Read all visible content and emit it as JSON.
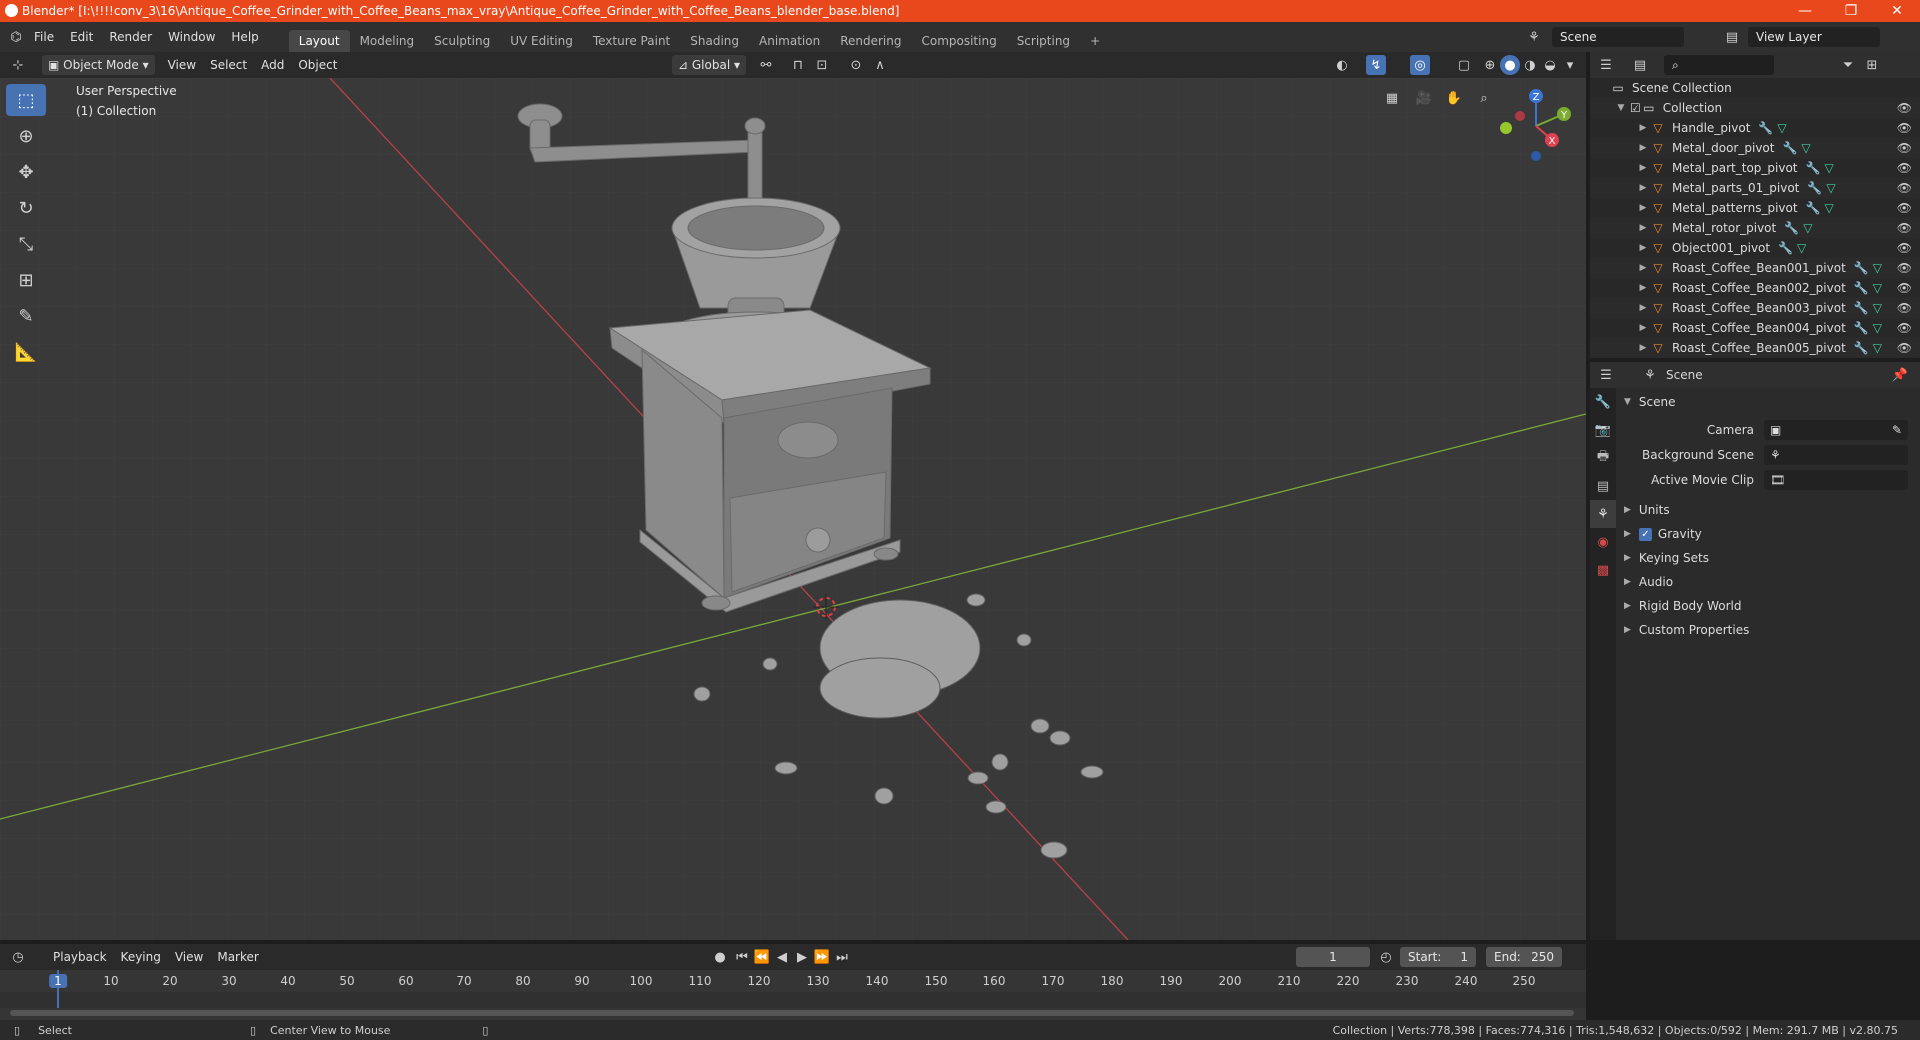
{
  "window": {
    "title": "Blender* [I:\\!!!!conv_3\\16\\Antique_Coffee_Grinder_with_Coffee_Beans_max_vray\\Antique_Coffee_Grinder_with_Coffee_Beans_blender_base.blend]",
    "minimize": "—",
    "maximize": "❐",
    "close": "✕"
  },
  "menu": [
    "File",
    "Edit",
    "Render",
    "Window",
    "Help"
  ],
  "workspaces": [
    "Layout",
    "Modeling",
    "Sculpting",
    "UV Editing",
    "Texture Paint",
    "Shading",
    "Animation",
    "Rendering",
    "Compositing",
    "Scripting"
  ],
  "active_workspace": "Layout",
  "scene_field": "Scene",
  "view_layer_field": "View Layer",
  "viewport_header": {
    "mode": "Object Mode",
    "menus": [
      "View",
      "Select",
      "Add",
      "Object"
    ],
    "transform_orientation": "Global"
  },
  "viewport": {
    "perspective_label": "User Perspective",
    "collection_label": "(1) Collection",
    "gizmo_axes": {
      "z": "Z",
      "y": "Y",
      "x": "X"
    }
  },
  "outliner": {
    "scene_collection": "Scene Collection",
    "collection": "Collection",
    "objects": [
      "Handle_pivot",
      "Metal_door_pivot",
      "Metal_part_top_pivot",
      "Metal_parts_01_pivot",
      "Metal_patterns_pivot",
      "Metal_rotor_pivot",
      "Object001_pivot",
      "Roast_Coffee_Bean001_pivot",
      "Roast_Coffee_Bean002_pivot",
      "Roast_Coffee_Bean003_pivot",
      "Roast_Coffee_Bean004_pivot",
      "Roast_Coffee_Bean005_pivot"
    ]
  },
  "properties": {
    "header": "Scene",
    "panel": "Scene",
    "fields": [
      {
        "label": "Camera",
        "value": ""
      },
      {
        "label": "Background Scene",
        "value": ""
      },
      {
        "label": "Active Movie Clip",
        "value": ""
      }
    ],
    "subpanels": [
      "Units",
      "Gravity",
      "Keying Sets",
      "Audio",
      "Rigid Body World",
      "Custom Properties"
    ],
    "gravity_checked": true
  },
  "timeline": {
    "menus": [
      "Playback",
      "Keying",
      "View",
      "Marker"
    ],
    "current_frame": "1",
    "start_label": "Start:",
    "start": "1",
    "end_label": "End:",
    "end": "250",
    "ticks": [
      "1",
      "10",
      "20",
      "30",
      "40",
      "50",
      "60",
      "70",
      "80",
      "90",
      "100",
      "110",
      "120",
      "130",
      "140",
      "150",
      "160",
      "170",
      "180",
      "190",
      "200",
      "210",
      "220",
      "230",
      "240",
      "250"
    ]
  },
  "statusbar": {
    "left1": "Select",
    "left2": "Center View to Mouse",
    "right": "Collection | Verts:778,398 | Faces:774,316 | Tris:1,548,632 | Objects:0/592 | Mem: 291.7 MB | v2.80.75"
  },
  "colors": {
    "titlebar": "#e8481b",
    "accent": "#4772b3",
    "viewport_bg": "#393939",
    "x_axis": "#c0404a",
    "y_axis": "#7aa83a",
    "object_icon": "#e8882a"
  }
}
